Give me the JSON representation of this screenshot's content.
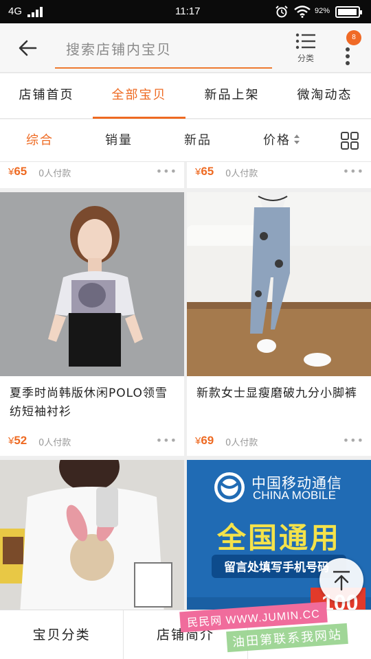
{
  "status_bar": {
    "carrier": "4G",
    "time": "11:17",
    "battery_percent": "92%"
  },
  "header": {
    "search_placeholder": "搜索店铺内宝贝",
    "category_label": "分类",
    "badge_count": "8"
  },
  "tabs": [
    {
      "label": "店铺首页",
      "active": false
    },
    {
      "label": "全部宝贝",
      "active": true
    },
    {
      "label": "新品上架",
      "active": false
    },
    {
      "label": "微淘动态",
      "active": false
    }
  ],
  "sort_bar": {
    "items": [
      {
        "label": "综合",
        "active": true
      },
      {
        "label": "销量",
        "active": false
      },
      {
        "label": "新品",
        "active": false
      },
      {
        "label": "价格",
        "active": false
      }
    ]
  },
  "products": {
    "partial_row": [
      {
        "currency": "¥",
        "price": "65",
        "sold": "0人付款"
      },
      {
        "currency": "¥",
        "price": "65",
        "sold": "0人付款"
      }
    ],
    "items": [
      {
        "title": "夏季时尚韩版休闲POLO领雪纺短袖衬衫",
        "currency": "¥",
        "price": "52",
        "sold": "0人付款"
      },
      {
        "title": "新款女士显瘦磨破九分小脚裤",
        "currency": "¥",
        "price": "69",
        "sold": "0人付款"
      }
    ],
    "ad": {
      "brand_cn": "中国移动通信",
      "brand_en": "CHINA MOBILE",
      "headline": "全国通用",
      "subline": "留言处填写手机号码",
      "corner_num": "100"
    }
  },
  "bottom_bar": {
    "items": [
      "宝贝分类",
      "店铺简介",
      ""
    ]
  },
  "watermark": {
    "line1": "民民网 WWW.JUMIN.CC",
    "line2": "油田第联系我网站"
  },
  "colors": {
    "accent": "#ee6a22",
    "badge": "#f06a26",
    "statusbar": "#0b0b0b"
  }
}
